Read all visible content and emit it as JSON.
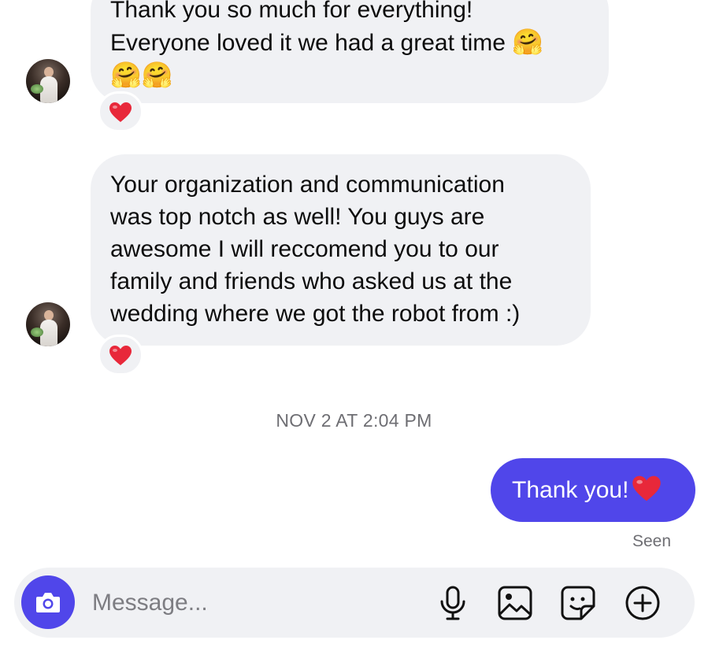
{
  "conversation": {
    "messages_received": [
      {
        "lines": [
          "Thank you so much for everything!",
          "Everyone loved it we had a great time"
        ],
        "emoji_inline": "🤗",
        "emoji_line": "🤗🤗",
        "reaction": "heart"
      },
      {
        "lines": [
          "Your organization and communication",
          "was top notch as well! You guys are",
          "awesome I will reccomend you to our",
          "family and friends who asked us at the",
          "wedding where we got the robot from :)"
        ],
        "reaction": "heart"
      }
    ],
    "timestamp": "NOV 2 AT 2:04 PM",
    "message_sent": {
      "text": "Thank you!",
      "emoji": "heart"
    },
    "seen_label": "Seen"
  },
  "composer": {
    "placeholder": "Message...",
    "icons": [
      "camera-icon",
      "microphone-icon",
      "gallery-icon",
      "sticker-icon",
      "add-icon"
    ]
  },
  "colors": {
    "accent": "#5046ea",
    "bubble_received": "#f0f1f4",
    "meta_text": "#6e6e73",
    "heart": "#e8283a"
  }
}
